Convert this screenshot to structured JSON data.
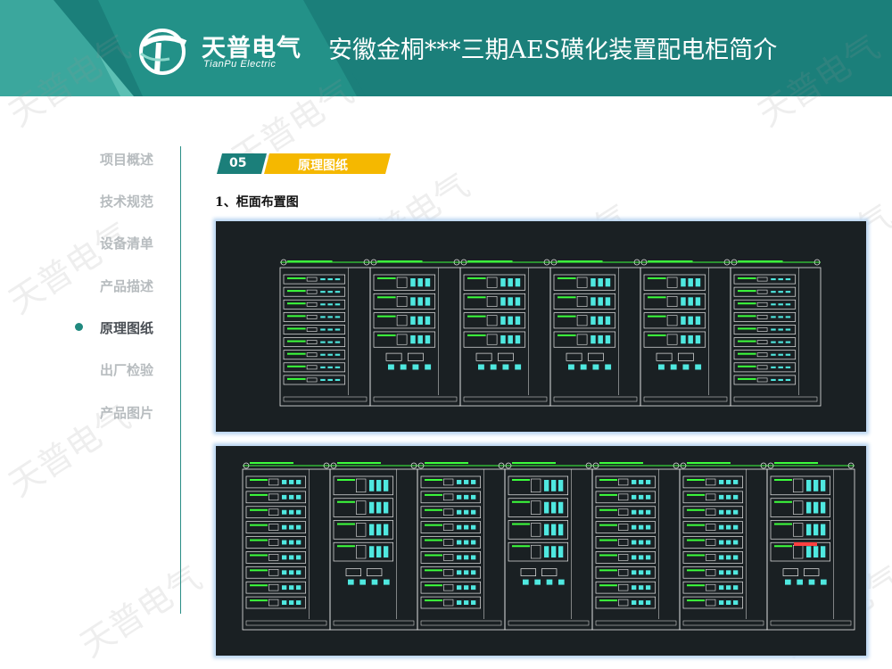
{
  "header": {
    "logo_cn": "天普电气",
    "logo_en": "TianPu Electric",
    "title": "安徽金桐***三期AES磺化装置配电柜简介"
  },
  "nav": {
    "items": [
      {
        "label": "项目概述",
        "active": false
      },
      {
        "label": "技术规范",
        "active": false
      },
      {
        "label": "设备清单",
        "active": false
      },
      {
        "label": "产品描述",
        "active": false
      },
      {
        "label": "原理图纸",
        "active": true
      },
      {
        "label": "出厂检验",
        "active": false
      },
      {
        "label": "产品图片",
        "active": false
      }
    ]
  },
  "section": {
    "number": "05",
    "title": "原理图纸",
    "subtitle": "1、柜面布置图"
  },
  "watermark": "天普电气",
  "colors": {
    "teal_dark": "#1b7f7a",
    "teal_light": "#3aaa9c",
    "accent_yellow": "#f5b800",
    "drawing_bg": "#1a2023",
    "cad_green": "#3cff3c",
    "cad_cyan": "#4fe8e0"
  }
}
